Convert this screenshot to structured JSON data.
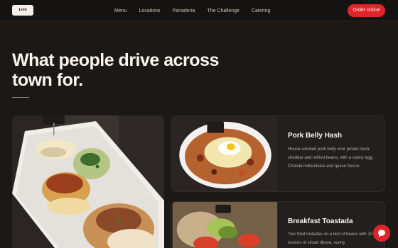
{
  "nav": {
    "logo_text": "LOS",
    "links": [
      "Menu",
      "Locations",
      "Panaderia",
      "The Challenge",
      "Catering"
    ],
    "order_button": "Order online"
  },
  "hero": {
    "title": "What people drive across town for."
  },
  "cards": [
    {
      "title": "Pork Belly Hash",
      "description": "House-smoked pork belly over potato hash, cheddar and refried beans, with a sunny egg, Cholula hollandaise and queso fresco."
    },
    {
      "title": "Breakfast Toastada",
      "description": "Two fried tostadas on a bed of beans with 10 ounces of sliced ribeye, sunny"
    }
  ],
  "colors": {
    "accent": "#e0242a",
    "background": "#1b1816",
    "card": "#221f1d"
  },
  "icons": {
    "chat": "chat-bubble-icon"
  }
}
